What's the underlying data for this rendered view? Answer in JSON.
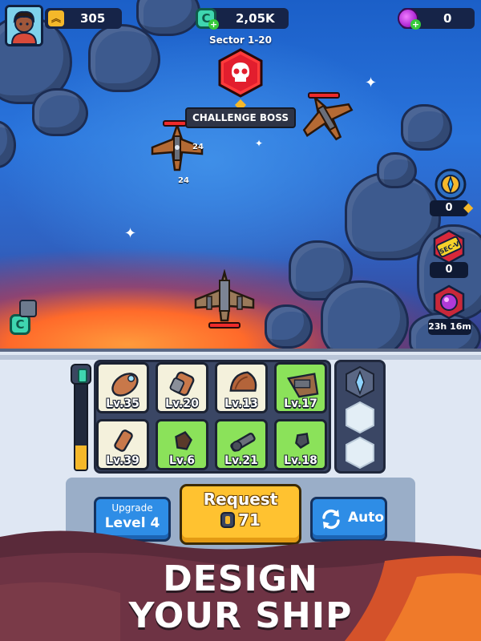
{
  "hud": {
    "rank_value": "305",
    "credits_value": "2,05K",
    "credits_icon_letter": "C",
    "gems_value": "0"
  },
  "battle": {
    "sector_label": "Sector 1-20",
    "boss_button_label": "CHALLENGE BOSS",
    "damage_labels": [
      "24",
      "24"
    ]
  },
  "side_items": [
    {
      "icon": "compass-emblem-icon",
      "count": "0"
    },
    {
      "icon": "sector-pass-card-icon",
      "count": "0",
      "card_text": "SEC-V"
    },
    {
      "icon": "mystery-core-icon",
      "timer": "23h 16m"
    }
  ],
  "collect_icon_letter": "C",
  "parts": [
    {
      "level": "Lv.35",
      "state": "normal",
      "icon": "cannon-pod-icon"
    },
    {
      "level": "Lv.20",
      "state": "normal",
      "icon": "thruster-part-icon"
    },
    {
      "level": "Lv.13",
      "state": "normal",
      "icon": "armor-shell-icon"
    },
    {
      "level": "Lv.17",
      "state": "ready",
      "icon": "wing-assembly-icon"
    },
    {
      "level": "Lv.39",
      "state": "normal",
      "icon": "small-barrel-icon"
    },
    {
      "level": "Lv.6",
      "state": "ready",
      "icon": "scrap-chunk-icon"
    },
    {
      "level": "Lv.21",
      "state": "ready",
      "icon": "turret-gun-icon"
    },
    {
      "level": "Lv.18",
      "state": "ready",
      "icon": "bolt-part-icon"
    }
  ],
  "fuel_level": 0.28,
  "buttons": {
    "upgrade_line1": "Upgrade",
    "upgrade_line2": "Level 4",
    "request_label": "Request",
    "request_cost": "71",
    "auto_label": "Auto"
  },
  "banner": {
    "line1": "DESIGN",
    "line2": "YOUR SHIP"
  },
  "colors": {
    "accent_yellow": "#ffc230",
    "button_blue": "#2e8de6",
    "ready_green": "#8be25a",
    "hp_red": "#ef2b2b"
  }
}
